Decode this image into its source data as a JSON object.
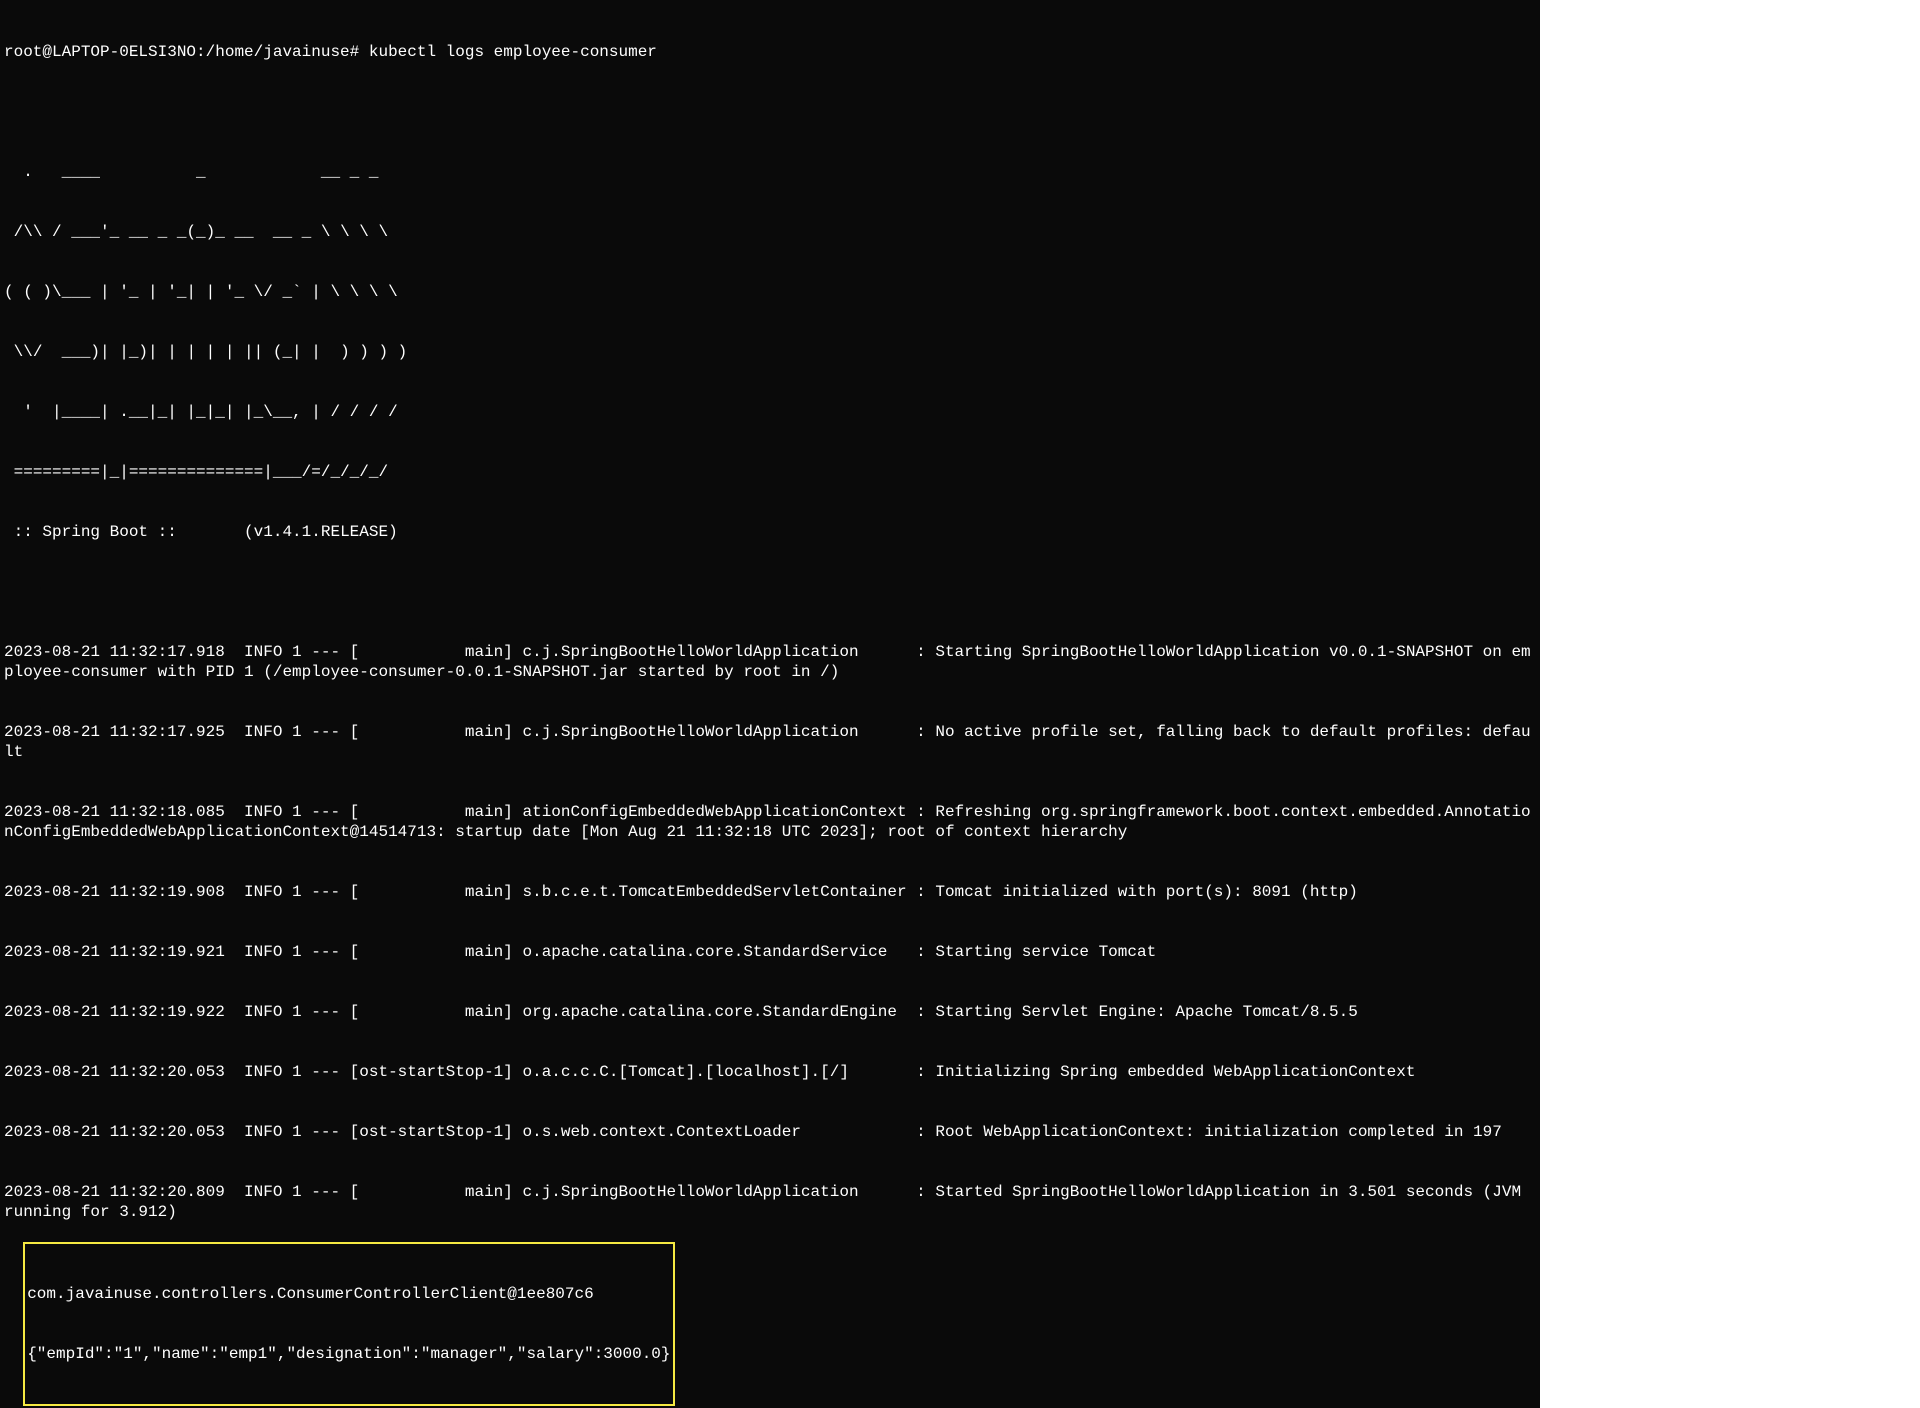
{
  "prompt": "root@LAPTOP-0ELSI3NO:/home/javainuse# kubectl logs employee-consumer",
  "banner_lines": [
    "  .   ____          _            __ _ _",
    " /\\\\ / ___'_ __ _ _(_)_ __  __ _ \\ \\ \\ \\",
    "( ( )\\___ | '_ | '_| | '_ \\/ _` | \\ \\ \\ \\",
    " \\\\/  ___)| |_)| | | | | || (_| |  ) ) ) )",
    "  '  |____| .__|_| |_|_| |_\\__, | / / / /",
    " =========|_|==============|___/=/_/_/_/",
    " :: Spring Boot ::       (v1.4.1.RELEASE)"
  ],
  "log_lines": [
    "2023-08-21 11:32:17.918  INFO 1 --- [           main] c.j.SpringBootHelloWorldApplication      : Starting SpringBootHelloWorldApplication v0.0.1-SNAPSHOT on employee-consumer with PID 1 (/employee-consumer-0.0.1-SNAPSHOT.jar started by root in /)",
    "2023-08-21 11:32:17.925  INFO 1 --- [           main] c.j.SpringBootHelloWorldApplication      : No active profile set, falling back to default profiles: default",
    "2023-08-21 11:32:18.085  INFO 1 --- [           main] ationConfigEmbeddedWebApplicationContext : Refreshing org.springframework.boot.context.embedded.AnnotationConfigEmbeddedWebApplicationContext@14514713: startup date [Mon Aug 21 11:32:18 UTC 2023]; root of context hierarchy",
    "2023-08-21 11:32:19.908  INFO 1 --- [           main] s.b.c.e.t.TomcatEmbeddedServletContainer : Tomcat initialized with port(s): 8091 (http)",
    "2023-08-21 11:32:19.921  INFO 1 --- [           main] o.apache.catalina.core.StandardService   : Starting service Tomcat",
    "2023-08-21 11:32:19.922  INFO 1 --- [           main] org.apache.catalina.core.StandardEngine  : Starting Servlet Engine: Apache Tomcat/8.5.5",
    "2023-08-21 11:32:20.053  INFO 1 --- [ost-startStop-1] o.a.c.c.C.[Tomcat].[localhost].[/]       : Initializing Spring embedded WebApplicationContext",
    "2023-08-21 11:32:20.053  INFO 1 --- [ost-startStop-1] o.s.web.context.ContextLoader            : Root WebApplicationContext: initialization completed in 197",
    "2023-08-21 11:32:20.809  INFO 1 --- [           main] c.j.SpringBootHelloWorldApplication      : Started SpringBootHelloWorldApplication in 3.501 seconds (JVM running for 3.912)"
  ],
  "highlighted": {
    "line1": "com.javainuse.controllers.ConsumerControllerClient@1ee807c6",
    "line2": "{\"empId\":\"1\",\"name\":\"emp1\",\"designation\":\"manager\",\"salary\":3000.0}"
  }
}
